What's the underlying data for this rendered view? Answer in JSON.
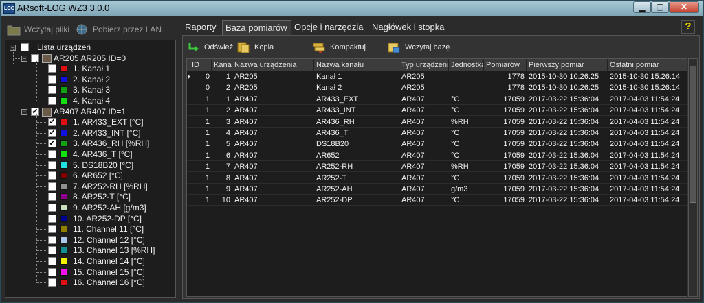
{
  "window": {
    "title": "ARsoft-LOG WZ3 3.0.0",
    "icon_text": "LOG"
  },
  "left_toolbar": {
    "load_files": "Wczytaj pliki",
    "download_lan": "Pobierz przez LAN"
  },
  "tree": {
    "root": "Lista urządzeń",
    "devices": [
      {
        "label": "AR205 AR205 ID=0",
        "checked": false,
        "channels": [
          {
            "label": "1. Kanał 1",
            "color": "#e01010",
            "checked": false
          },
          {
            "label": "2. Kanał 2",
            "color": "#1010e0",
            "checked": false
          },
          {
            "label": "3. Kanał 3",
            "color": "#10a010",
            "checked": false
          },
          {
            "label": "4. Kanał 4",
            "color": "#10e010",
            "checked": false
          }
        ]
      },
      {
        "label": "AR407 AR407 ID=1",
        "checked": true,
        "channels": [
          {
            "label": "1. AR433_EXT [°C]",
            "color": "#e01010",
            "checked": true
          },
          {
            "label": "2. AR433_INT [°C]",
            "color": "#1010e0",
            "checked": true
          },
          {
            "label": "3. AR436_RH [%RH]",
            "color": "#10a010",
            "checked": true
          },
          {
            "label": "4. AR436_T [°C]",
            "color": "#10e010",
            "checked": false
          },
          {
            "label": "5. DS18B20 [°C]",
            "color": "#20e0e0",
            "checked": false
          },
          {
            "label": "6. AR652 [°C]",
            "color": "#800000",
            "checked": false
          },
          {
            "label": "7. AR252-RH [%RH]",
            "color": "#909090",
            "checked": false
          },
          {
            "label": "8. AR252-T [°C]",
            "color": "#900090",
            "checked": false
          },
          {
            "label": "9. AR252-AH [g/m3]",
            "color": "#c8e0c0",
            "checked": false
          },
          {
            "label": "10. AR252-DP [°C]",
            "color": "#000090",
            "checked": false
          },
          {
            "label": "11. Channel 11 [°C]",
            "color": "#908000",
            "checked": false
          },
          {
            "label": "12. Channel 12 [°C]",
            "color": "#b0c8e8",
            "checked": false
          },
          {
            "label": "13. Channel 13 [%RH]",
            "color": "#109090",
            "checked": false
          },
          {
            "label": "14. Channel 14 [°C]",
            "color": "#f0f000",
            "checked": false
          },
          {
            "label": "15. Channel 15 [°C]",
            "color": "#f010f0",
            "checked": false
          },
          {
            "label": "16. Channel 16 [°C]",
            "color": "#e01010",
            "checked": false
          }
        ]
      }
    ]
  },
  "tabs": [
    "Raporty",
    "Baza pomiarów",
    "Opcje i narzędzia",
    "Nagłówek i stopka"
  ],
  "active_tab": 1,
  "help_label": "?",
  "db_toolbar": {
    "refresh": "Odśwież",
    "backup": "Kopia zapasowa",
    "compact": "Kompaktuj bazę",
    "load": "Wczytaj bazę"
  },
  "table": {
    "columns": [
      "ID",
      "Kanał",
      "Nazwa urządzenia",
      "Nazwa kanału",
      "Typ urządzenia",
      "Jednostka",
      "Pomiarów",
      "Pierwszy pomiar",
      "Ostatni pomiar"
    ],
    "rows": [
      [
        "0",
        "1",
        "AR205",
        "Kanał 1",
        "AR205",
        "",
        "1778",
        "2015-10-30 10:26:25",
        "2015-10-30 15:26:14"
      ],
      [
        "0",
        "2",
        "AR205",
        "Kanał 2",
        "AR205",
        "",
        "1778",
        "2015-10-30 10:26:25",
        "2015-10-30 15:26:14"
      ],
      [
        "1",
        "1",
        "AR407",
        "AR433_EXT",
        "AR407",
        "°C",
        "17059",
        "2017-03-22 15:36:04",
        "2017-04-03 11:54:24"
      ],
      [
        "1",
        "2",
        "AR407",
        "AR433_INT",
        "AR407",
        "°C",
        "17059",
        "2017-03-22 15:36:04",
        "2017-04-03 11:54:24"
      ],
      [
        "1",
        "3",
        "AR407",
        "AR436_RH",
        "AR407",
        "%RH",
        "17059",
        "2017-03-22 15:36:04",
        "2017-04-03 11:54:24"
      ],
      [
        "1",
        "4",
        "AR407",
        "AR436_T",
        "AR407",
        "°C",
        "17059",
        "2017-03-22 15:36:04",
        "2017-04-03 11:54:24"
      ],
      [
        "1",
        "5",
        "AR407",
        "DS18B20",
        "AR407",
        "°C",
        "17059",
        "2017-03-22 15:36:04",
        "2017-04-03 11:54:24"
      ],
      [
        "1",
        "6",
        "AR407",
        "AR652",
        "AR407",
        "°C",
        "17059",
        "2017-03-22 15:36:04",
        "2017-04-03 11:54:24"
      ],
      [
        "1",
        "7",
        "AR407",
        "AR252-RH",
        "AR407",
        "%RH",
        "17059",
        "2017-03-22 15:36:04",
        "2017-04-03 11:54:24"
      ],
      [
        "1",
        "8",
        "AR407",
        "AR252-T",
        "AR407",
        "°C",
        "17059",
        "2017-03-22 15:36:04",
        "2017-04-03 11:54:24"
      ],
      [
        "1",
        "9",
        "AR407",
        "AR252-AH",
        "AR407",
        "g/m3",
        "17059",
        "2017-03-22 15:36:04",
        "2017-04-03 11:54:24"
      ],
      [
        "1",
        "10",
        "AR407",
        "AR252-DP",
        "AR407",
        "°C",
        "17059",
        "2017-03-22 15:36:04",
        "2017-04-03 11:54:24"
      ]
    ]
  }
}
